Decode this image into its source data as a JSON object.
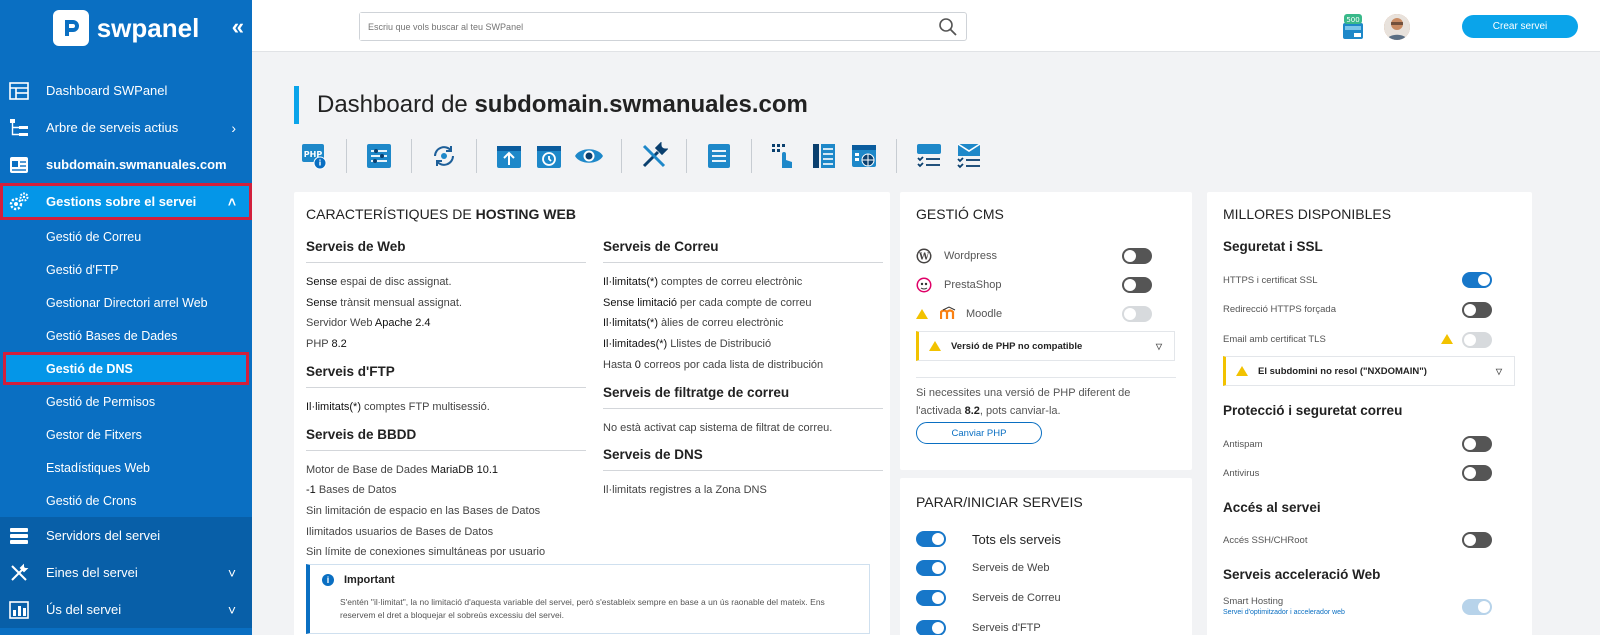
{
  "sidebar": {
    "logo_text": "swpanel",
    "collapse_icon": "«",
    "items": [
      {
        "label": "Dashboard SWPanel",
        "icon": "dashboard-icon"
      },
      {
        "label": "Arbre de serveis actius",
        "icon": "tree-icon",
        "arrow": "›"
      },
      {
        "label": "subdomain.swmanuales.com",
        "icon": "server-card-icon"
      },
      {
        "label": "Gestions sobre el servei",
        "icon": "gears-icon",
        "arrow": "˄"
      }
    ],
    "subitems": [
      {
        "label": "Gestió de Correu"
      },
      {
        "label": "Gestió d'FTP"
      },
      {
        "label": "Gestionar Directori arrel Web"
      },
      {
        "label": "Gestió Bases de Dades"
      },
      {
        "label": "Gestió de DNS"
      },
      {
        "label": "Gestió de Permisos"
      },
      {
        "label": "Gestor de Fitxers"
      },
      {
        "label": "Estadístiques Web"
      },
      {
        "label": "Gestió de Crons"
      }
    ],
    "bottom_items": [
      {
        "label": "Servidors del servei",
        "icon": "servers-icon"
      },
      {
        "label": "Eines del servei",
        "icon": "tools-icon",
        "arrow": "˅"
      },
      {
        "label": "Ús del servei",
        "icon": "usage-icon",
        "arrow": "˅"
      }
    ]
  },
  "topbar": {
    "search_placeholder": "Escriu que vols buscar al teu SWPanel",
    "badge_text": "500",
    "create_button": "Crear servei"
  },
  "page": {
    "title_prefix": "Dashboard de ",
    "title_domain": "subdomain.swmanuales.com"
  },
  "toolbar_icons": [
    [
      "php-info-icon"
    ],
    [
      "list-settings-icon"
    ],
    [
      "sync-icon"
    ],
    [
      "upload-icon",
      "restore-icon",
      "eye-icon"
    ],
    [
      "wrench-screwdriver-icon"
    ],
    [
      "document-list-icon"
    ],
    [
      "touch-grid-icon",
      "file-list-icon",
      "web-grid-icon"
    ],
    [
      "checklist-window-icon",
      "mail-checklist-icon"
    ]
  ],
  "hosting": {
    "title_prefix": "CARACTERÍSTIQUES DE ",
    "title_bold": "HOSTING WEB",
    "web": {
      "heading": "Serveis de Web",
      "lines": [
        [
          "Sense",
          " espai de disc assignat."
        ],
        [
          "Sense",
          " trànsit mensual assignat."
        ],
        [
          "Servidor Web ",
          "Apache 2.4"
        ],
        [
          "PHP ",
          "8.2"
        ]
      ]
    },
    "ftp": {
      "heading": "Serveis d'FTP",
      "lines": [
        [
          "Il·limitats(*)",
          " comptes FTP multisessió."
        ]
      ]
    },
    "bbdd": {
      "heading": "Serveis de BBDD",
      "lines": [
        [
          "Motor de Base de Dades ",
          "MariaDB 10.1"
        ],
        [
          "-1",
          " Bases de Datos"
        ],
        [
          "Sin limitación de espacio en las Bases de Datos",
          ""
        ],
        [
          "Ilimitados usuarios de Bases de Datos",
          ""
        ],
        [
          "Sin límite de conexiones simultáneas por usuario",
          ""
        ]
      ]
    },
    "correu": {
      "heading": "Serveis de Correu",
      "lines": [
        [
          "Il·limitats(*)",
          " comptes de correu electrònic"
        ],
        [
          "Sense limitació",
          " per cada compte de correu"
        ],
        [
          "Il·limitats(*)",
          " àlies de correu electrònic"
        ],
        [
          "Il·limitades(*)",
          " Llistes de Distribució"
        ],
        [
          "Hasta ",
          "0",
          " correos por cada lista de distribución"
        ]
      ]
    },
    "filtratge": {
      "heading": "Serveis de filtratge de correu",
      "lines": [
        [
          "No està activat cap sistema de filtrat de correu.",
          ""
        ]
      ]
    },
    "dns": {
      "heading": "Serveis de DNS",
      "lines": [
        [
          "Il·limitats registres a la Zona DNS",
          ""
        ]
      ]
    },
    "important_title": "Important",
    "important_text": "S'entén \"il·limitat\", la no limitació d'aquesta variable del servei, però s'estableix sempre en base a un ús raonable del mateix. Ens reservem el dret a bloquejar el sobreús excessiu del servei."
  },
  "cms": {
    "title": "GESTIÓ CMS",
    "items": [
      {
        "label": "Wordpress",
        "icon": "wordpress-icon",
        "state": "off"
      },
      {
        "label": "PrestaShop",
        "icon": "prestashop-icon",
        "state": "off"
      },
      {
        "label": "Moodle",
        "icon": "moodle-icon",
        "state": "disabled"
      }
    ],
    "warning": "Versió de PHP no compatible",
    "note_a": "Si necessites una versió de PHP diferent de l'activada ",
    "note_version": "8.2",
    "note_b": ", pots canviar-la.",
    "button": "Canviar PHP"
  },
  "services": {
    "title": "PARAR/INICIAR SERVEIS",
    "items": [
      {
        "label": "Tots els serveis",
        "state": "on"
      },
      {
        "label": "Serveis de Web",
        "state": "on"
      },
      {
        "label": "Serveis de Correu",
        "state": "on"
      },
      {
        "label": "Serveis d'FTP",
        "state": "on"
      }
    ]
  },
  "upgrades": {
    "title": "MILLORES DISPONIBLES",
    "ssl_heading": "Seguretat i SSL",
    "ssl_items": [
      {
        "label": "HTTPS i certificat SSL",
        "state": "on"
      },
      {
        "label": "Redirecció HTTPS forçada",
        "state": "off"
      },
      {
        "label": "Email amb certificat TLS",
        "state": "disabled"
      }
    ],
    "ssl_warning": "El subdomini no resol (\"NXDOMAIN\")",
    "mail_heading": "Protecció i seguretat correu",
    "mail_items": [
      {
        "label": "Antispam",
        "state": "off"
      },
      {
        "label": "Antivirus",
        "state": "off"
      }
    ],
    "access_heading": "Accés al servei",
    "access_items": [
      {
        "label": "Accés SSH/CHRoot",
        "state": "off"
      }
    ],
    "accel_heading": "Serveis acceleració Web",
    "accel_items": [
      {
        "label": "Smart Hosting",
        "sub": "Servei d'optimitzador i accelerador web",
        "state": "disabled-on"
      }
    ]
  },
  "colors": {
    "sidebar": "#0a6fc2",
    "accent": "#0aa4ea",
    "highlight_border": "#d21f3c",
    "warning": "#f2c200"
  }
}
